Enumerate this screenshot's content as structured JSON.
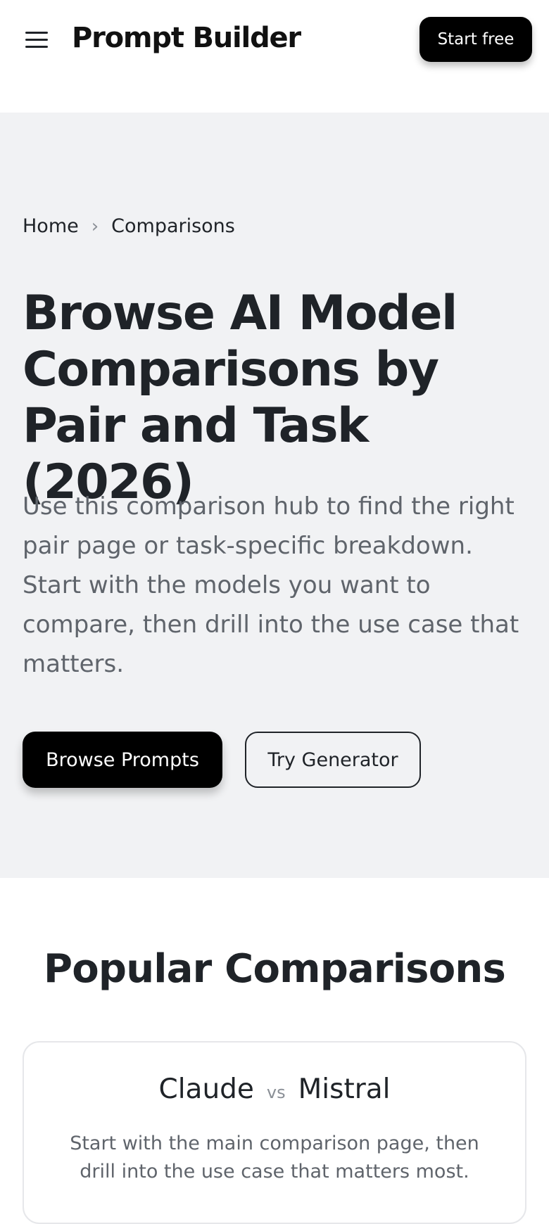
{
  "header": {
    "logo": "Prompt Builder",
    "start_free_label": "Start free",
    "menu_icon": "hamburger-menu-icon"
  },
  "breadcrumb": {
    "items": [
      "Home",
      "Comparisons"
    ],
    "separator_icon": "chevron-right-icon",
    "separator_glyph": "›"
  },
  "hero": {
    "title": "Browse AI Model Comparisons by Pair and Task (2026)",
    "description": "Use this comparison hub to find the right pair page or task-specific breakdown. Start with the models you want to compare, then drill into the use case that matters.",
    "primary_cta": "Browse Prompts",
    "secondary_cta": "Try Generator"
  },
  "popular": {
    "title": "Popular Comparisons",
    "cards": [
      {
        "model_a": "Claude",
        "vs": "vs",
        "model_b": "Mistral",
        "description": "Start with the main comparison page, then drill into the use case that matters most."
      }
    ]
  },
  "colors": {
    "hero_background": "#f1f2f4",
    "primary_button": "#000000",
    "text": "#1f2328",
    "muted_text": "#5f646b"
  }
}
